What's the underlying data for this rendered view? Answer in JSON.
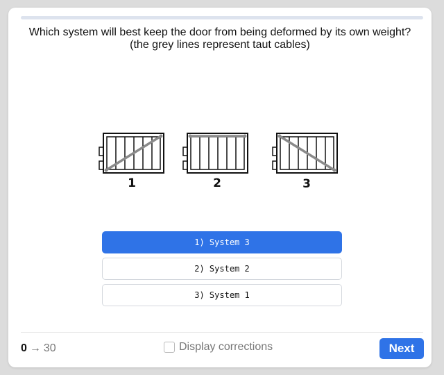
{
  "progress": {
    "fraction": 0.0
  },
  "question": {
    "text": "Which system will best keep the door from being deformed by its own weight? (the grey lines represent taut cables)"
  },
  "figure": {
    "diagrams": [
      {
        "label": "1",
        "cable": "diagonal-lower-left-to-upper-right"
      },
      {
        "label": "2",
        "cable": "horizontal-top"
      },
      {
        "label": "3",
        "cable": "diagonal-upper-left-to-lower-right"
      }
    ],
    "cable_color": "#8a8a8a"
  },
  "options": [
    {
      "label": "1) System 3",
      "selected": true
    },
    {
      "label": "2) System 2",
      "selected": false
    },
    {
      "label": "3) System 1",
      "selected": false
    }
  ],
  "footer": {
    "score_current": "0",
    "score_arrow": "→",
    "score_total": "30",
    "corrections_label": "Display corrections",
    "corrections_checked": false,
    "next_label": "Next"
  },
  "colors": {
    "accent": "#2f73e7",
    "track": "#dde3ee"
  }
}
